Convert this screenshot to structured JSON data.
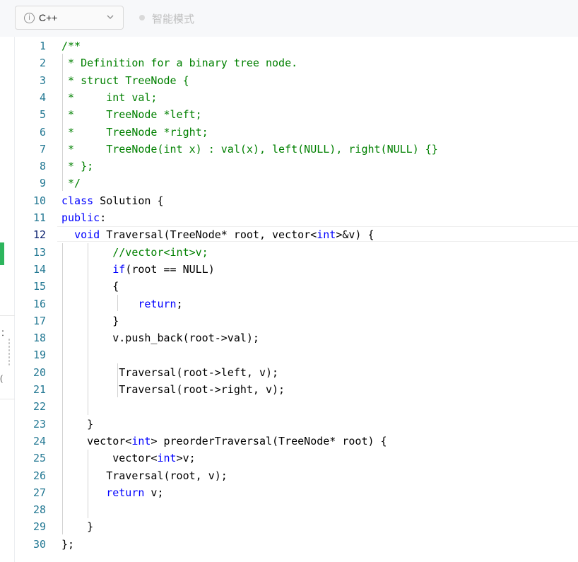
{
  "toolbar": {
    "language": "C++",
    "mode_label": "智能模式"
  },
  "icons": {
    "info": "info-circle-icon",
    "chevron": "chevron-down-icon"
  },
  "colors": {
    "comment": "#008000",
    "keyword": "#0000ff",
    "plain": "#000000",
    "line_number": "#237893",
    "active_line_number": "#0b216f",
    "accent_green": "#2db55d"
  },
  "editor": {
    "active_line": 12,
    "lines": [
      [
        [
          "c",
          "/**"
        ]
      ],
      [
        [
          "c",
          " * Definition for a binary tree node."
        ]
      ],
      [
        [
          "c",
          " * struct TreeNode {"
        ]
      ],
      [
        [
          "c",
          " *     int val;"
        ]
      ],
      [
        [
          "c",
          " *     TreeNode *left;"
        ]
      ],
      [
        [
          "c",
          " *     TreeNode *right;"
        ]
      ],
      [
        [
          "c",
          " *     TreeNode(int x) : val(x), left(NULL), right(NULL) {}"
        ]
      ],
      [
        [
          "c",
          " * };"
        ]
      ],
      [
        [
          "c",
          " */"
        ]
      ],
      [
        [
          "k",
          "class"
        ],
        [
          "p",
          " Solution {"
        ]
      ],
      [
        [
          "k",
          "public"
        ],
        [
          "p",
          ":"
        ]
      ],
      [
        [
          "p",
          "  "
        ],
        [
          "k",
          "void"
        ],
        [
          "p",
          " Traversal(TreeNode* root, vector<"
        ],
        [
          "k",
          "int"
        ],
        [
          "p",
          ">&v) {"
        ]
      ],
      [
        [
          "p",
          "        "
        ],
        [
          "c",
          "//vector<int>v;"
        ]
      ],
      [
        [
          "p",
          "        "
        ],
        [
          "k",
          "if"
        ],
        [
          "p",
          "(root == NULL)"
        ]
      ],
      [
        [
          "p",
          "        {"
        ]
      ],
      [
        [
          "p",
          "            "
        ],
        [
          "k",
          "return"
        ],
        [
          "p",
          ";"
        ]
      ],
      [
        [
          "p",
          "        }"
        ]
      ],
      [
        [
          "p",
          "        v.push_back(root->val);"
        ]
      ],
      [
        [
          "p",
          ""
        ]
      ],
      [
        [
          "p",
          "         Traversal(root->left, v);"
        ]
      ],
      [
        [
          "p",
          "         Traversal(root->right, v);"
        ]
      ],
      [
        [
          "p",
          ""
        ]
      ],
      [
        [
          "p",
          "    }"
        ]
      ],
      [
        [
          "p",
          "    vector<"
        ],
        [
          "k",
          "int"
        ],
        [
          "p",
          "> preorderTraversal(TreeNode* root) {"
        ]
      ],
      [
        [
          "p",
          "        vector<"
        ],
        [
          "k",
          "int"
        ],
        [
          "p",
          ">v;"
        ]
      ],
      [
        [
          "p",
          "       Traversal(root, v);"
        ]
      ],
      [
        [
          "p",
          "       "
        ],
        [
          "k",
          "return"
        ],
        [
          "p",
          " v;"
        ]
      ],
      [
        [
          "p",
          ""
        ]
      ],
      [
        [
          "p",
          "    }"
        ]
      ],
      [
        [
          "p",
          "};"
        ]
      ]
    ]
  },
  "left_strip": {
    "char1": "：",
    "char2": "("
  }
}
